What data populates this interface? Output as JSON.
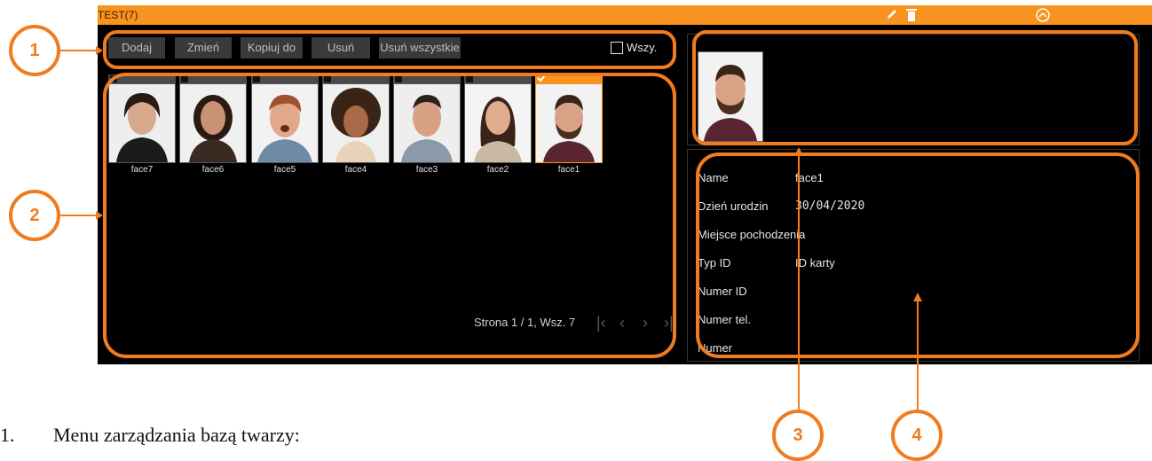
{
  "window": {
    "title": "TEST(7)"
  },
  "toolbar": {
    "buttons": [
      "Dodaj",
      "Zmień",
      "Kopiuj do",
      "Usuń",
      "Usuń wszystkie"
    ],
    "select_all_label": "Wszy."
  },
  "faces": [
    {
      "name": "face7",
      "selected": false
    },
    {
      "name": "face6",
      "selected": false
    },
    {
      "name": "face5",
      "selected": false
    },
    {
      "name": "face4",
      "selected": false
    },
    {
      "name": "face3",
      "selected": false
    },
    {
      "name": "face2",
      "selected": false
    },
    {
      "name": "face1",
      "selected": true
    }
  ],
  "pager": {
    "text": "Strona 1 / 1, Wsz. 7"
  },
  "details": {
    "fields": [
      {
        "label": "Name",
        "value": "face1"
      },
      {
        "label": "Dzień urodzin",
        "value": "30/04/2020"
      },
      {
        "label": "Miejsce pochodzenia",
        "value": ""
      },
      {
        "label": "Typ ID",
        "value": "ID karty"
      },
      {
        "label": "Numer ID",
        "value": ""
      },
      {
        "label": "Numer tel.",
        "value": ""
      },
      {
        "label": "Numer",
        "value": ""
      }
    ]
  },
  "callouts": [
    "1",
    "2",
    "3",
    "4"
  ],
  "caption": {
    "number": "1.",
    "text": "Menu zarządzania bazą twarzy:"
  },
  "colors": {
    "accent": "#f7931e",
    "callout": "#f07c1f"
  }
}
